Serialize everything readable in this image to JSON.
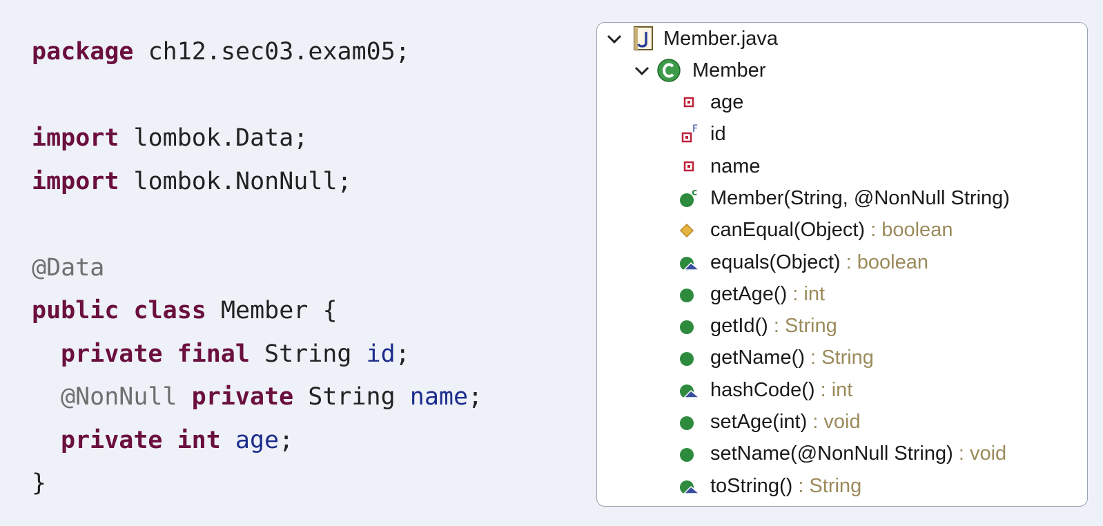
{
  "code": {
    "kw_package": "package",
    "package_name": " ch12.sec03.exam05;",
    "kw_import": "import",
    "import1": " lombok.Data;",
    "import2": " lombok.NonNull;",
    "ann_data": "@Data",
    "kw_public": "public",
    "kw_class": "class",
    "class_name": " Member {",
    "kw_private": "private",
    "kw_final": "final",
    "type_string": " String ",
    "field_id": "id",
    "semi": ";",
    "ann_nonnull": "@NonNull",
    "field_name": "name",
    "kw_int": "int",
    "field_age": "age",
    "close_brace": "}"
  },
  "outline": {
    "file": {
      "label": "Member.java",
      "icon": "java-file-icon"
    },
    "class": {
      "label": "Member",
      "icon": "class-icon"
    },
    "members": [
      {
        "label": "age",
        "ret": "",
        "icon": "private-field-icon"
      },
      {
        "label": "id",
        "ret": "",
        "icon": "private-final-field-icon"
      },
      {
        "label": "name",
        "ret": "",
        "icon": "private-field-icon"
      },
      {
        "label": "Member(String, @NonNull String)",
        "ret": "",
        "icon": "constructor-icon"
      },
      {
        "label": "canEqual(Object)",
        "ret": " : boolean",
        "icon": "protected-method-icon"
      },
      {
        "label": "equals(Object)",
        "ret": " : boolean",
        "icon": "override-method-icon"
      },
      {
        "label": "getAge()",
        "ret": " : int",
        "icon": "public-method-icon"
      },
      {
        "label": "getId()",
        "ret": " : String",
        "icon": "public-method-icon"
      },
      {
        "label": "getName()",
        "ret": " : String",
        "icon": "public-method-icon"
      },
      {
        "label": "hashCode()",
        "ret": " : int",
        "icon": "override-method-icon"
      },
      {
        "label": "setAge(int)",
        "ret": " : void",
        "icon": "public-method-icon"
      },
      {
        "label": "setName(@NonNull String)",
        "ret": " : void",
        "icon": "public-method-icon"
      },
      {
        "label": "toString()",
        "ret": " : String",
        "icon": "override-method-icon"
      }
    ]
  },
  "colors": {
    "keyword": "#6a0f3e",
    "annotation": "#6f6f6f",
    "field": "#1c2c8c",
    "method_green": "#2e8b3e",
    "private_red": "#c0203a",
    "protected_yellow": "#e6b440",
    "return_type": "#9b8a5a"
  }
}
